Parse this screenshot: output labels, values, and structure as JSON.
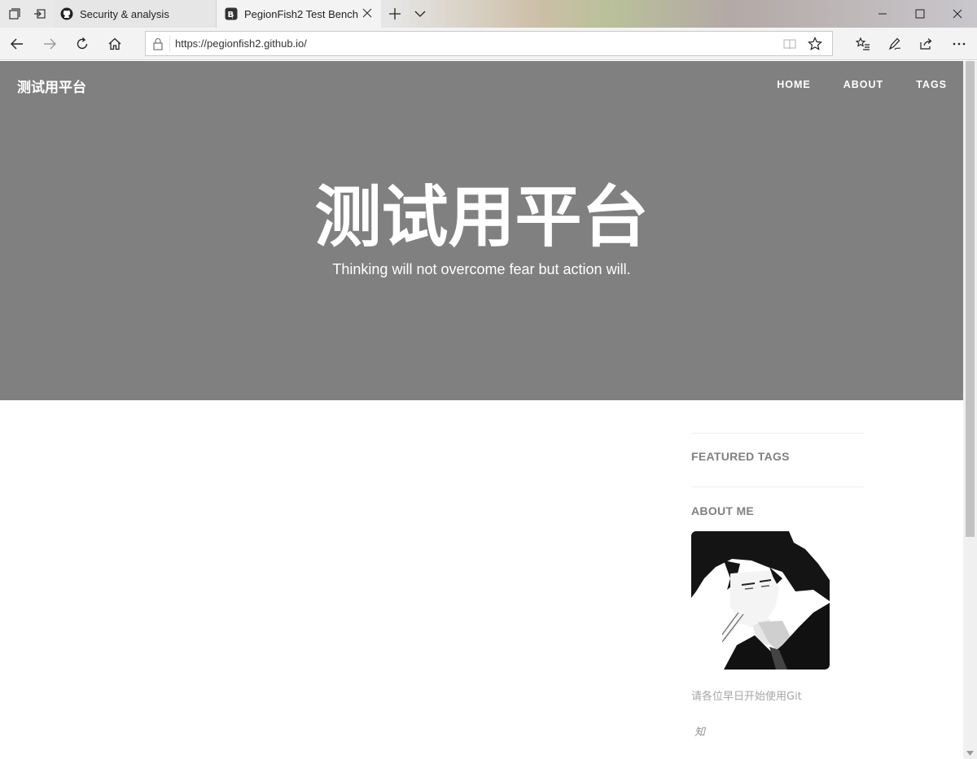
{
  "browser": {
    "tabs": [
      {
        "label": "Security & analysis",
        "icon": "github-icon",
        "active": false
      },
      {
        "label": "PegionFish2 Test Bench",
        "icon": "site-favicon-icon",
        "active": true
      }
    ],
    "url": "https://pegionfish2.github.io/"
  },
  "site": {
    "brand": "测试用平台",
    "nav": [
      "HOME",
      "ABOUT",
      "TAGS"
    ],
    "hero_title": "测试用平台",
    "hero_subtitle": "Thinking will not overcome fear but action will."
  },
  "sidebar": {
    "featured_tags_heading": "FEATURED TAGS",
    "about_me_heading": "ABOUT ME",
    "bio": "请各位早日开始使用Git",
    "social_link": "知"
  },
  "colors": {
    "hero_bg": "#808080",
    "sidebar_heading": "#808080",
    "bio_text": "#a6a6a6"
  }
}
